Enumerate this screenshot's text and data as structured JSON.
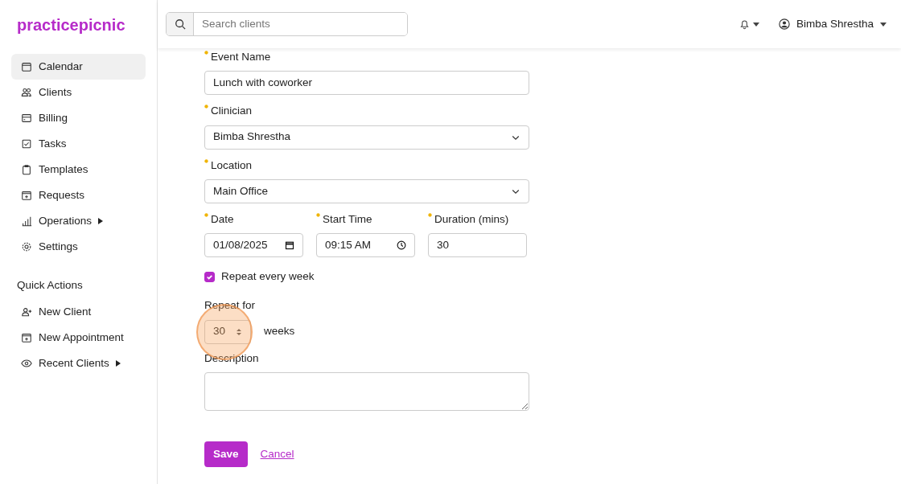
{
  "brand": "practicepicnic",
  "search": {
    "placeholder": "Search clients"
  },
  "user": {
    "name": "Bimba Shrestha"
  },
  "sidebar": {
    "items": [
      {
        "label": "Calendar",
        "selected": true,
        "submenu": false
      },
      {
        "label": "Clients",
        "selected": false,
        "submenu": false
      },
      {
        "label": "Billing",
        "selected": false,
        "submenu": false
      },
      {
        "label": "Tasks",
        "selected": false,
        "submenu": false
      },
      {
        "label": "Templates",
        "selected": false,
        "submenu": false
      },
      {
        "label": "Requests",
        "selected": false,
        "submenu": false
      },
      {
        "label": "Operations",
        "selected": false,
        "submenu": true
      },
      {
        "label": "Settings",
        "selected": false,
        "submenu": false
      }
    ]
  },
  "quick_actions": {
    "title": "Quick Actions",
    "items": [
      {
        "label": "New Client",
        "submenu": false
      },
      {
        "label": "New Appointment",
        "submenu": false
      },
      {
        "label": "Recent Clients",
        "submenu": true
      }
    ]
  },
  "form": {
    "event_name": {
      "label": "Event Name",
      "required": true,
      "value": "Lunch with coworker"
    },
    "clinician": {
      "label": "Clinician",
      "required": true,
      "value": "Bimba Shrestha"
    },
    "location": {
      "label": "Location",
      "required": true,
      "value": "Main Office"
    },
    "date": {
      "label": "Date",
      "required": true,
      "value": "01/08/2025"
    },
    "start_time": {
      "label": "Start Time",
      "required": true,
      "value": "09:15 AM"
    },
    "duration": {
      "label": "Duration (mins)",
      "required": true,
      "value": "30"
    },
    "repeat": {
      "label": "Repeat every week",
      "checked": true
    },
    "repeat_for": {
      "label": "Repeat for",
      "value": "30",
      "unit": "weeks",
      "highlighted": true
    },
    "description": {
      "label": "Description"
    },
    "save": "Save",
    "cancel": "Cancel"
  }
}
